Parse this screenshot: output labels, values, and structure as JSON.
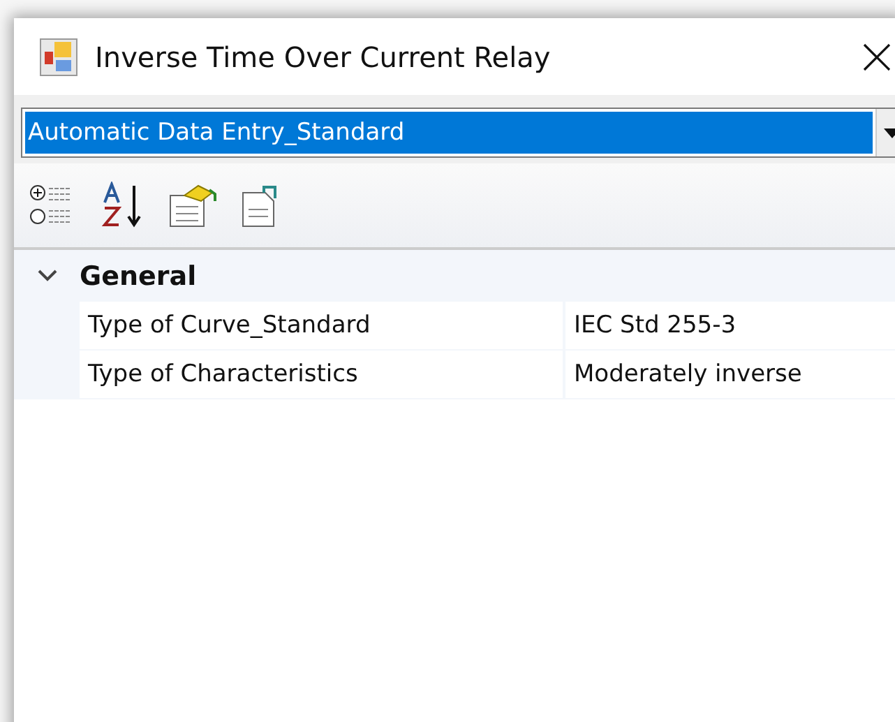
{
  "window": {
    "title": "Inverse Time Over Current Relay"
  },
  "selector": {
    "value": "Automatic Data Entry_Standard",
    "selected": true
  },
  "grid": {
    "categories": [
      {
        "name": "General",
        "expanded": true,
        "properties": [
          {
            "name": "Type of Curve_Standard",
            "value": "IEC Std 255-3"
          },
          {
            "name": "Type of Characteristics",
            "value": "Moderately inverse"
          }
        ]
      }
    ]
  }
}
